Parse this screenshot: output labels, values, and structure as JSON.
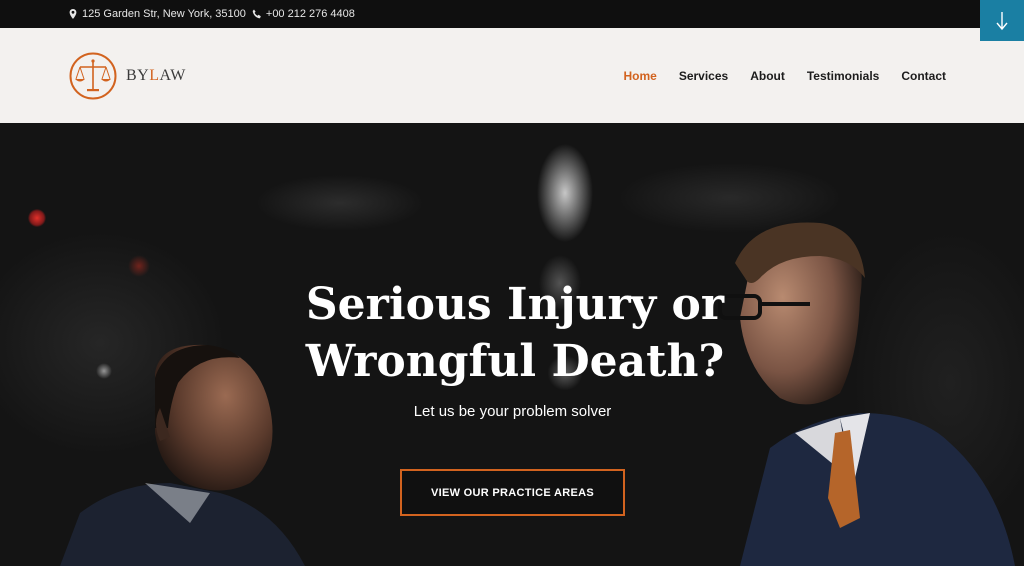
{
  "topbar": {
    "address": "125 Garden Str, New York, 35100",
    "phone": "+00 212 276 4408",
    "address_icon": "map-pin-icon",
    "phone_icon": "phone-icon",
    "scroll_icon": "arrow-down-icon"
  },
  "header": {
    "logo_part1": "BY",
    "logo_accent": "L",
    "logo_part2": "AW",
    "logo_icon": "scales-of-justice-icon",
    "nav": [
      {
        "label": "Home",
        "active": true
      },
      {
        "label": "Services",
        "active": false
      },
      {
        "label": "About",
        "active": false
      },
      {
        "label": "Testimonials",
        "active": false
      },
      {
        "label": "Contact",
        "active": false
      }
    ]
  },
  "hero": {
    "headline_line1": "Serious Injury or",
    "headline_line2": "Wrongful Death?",
    "tagline": "Let us be your problem solver",
    "cta": "VIEW OUR PRACTICE AREAS"
  },
  "colors": {
    "accent": "#d2631f",
    "scroll_button": "#1a7fa3",
    "topbar": "#0f0f0f",
    "header": "#f3f1ef"
  }
}
